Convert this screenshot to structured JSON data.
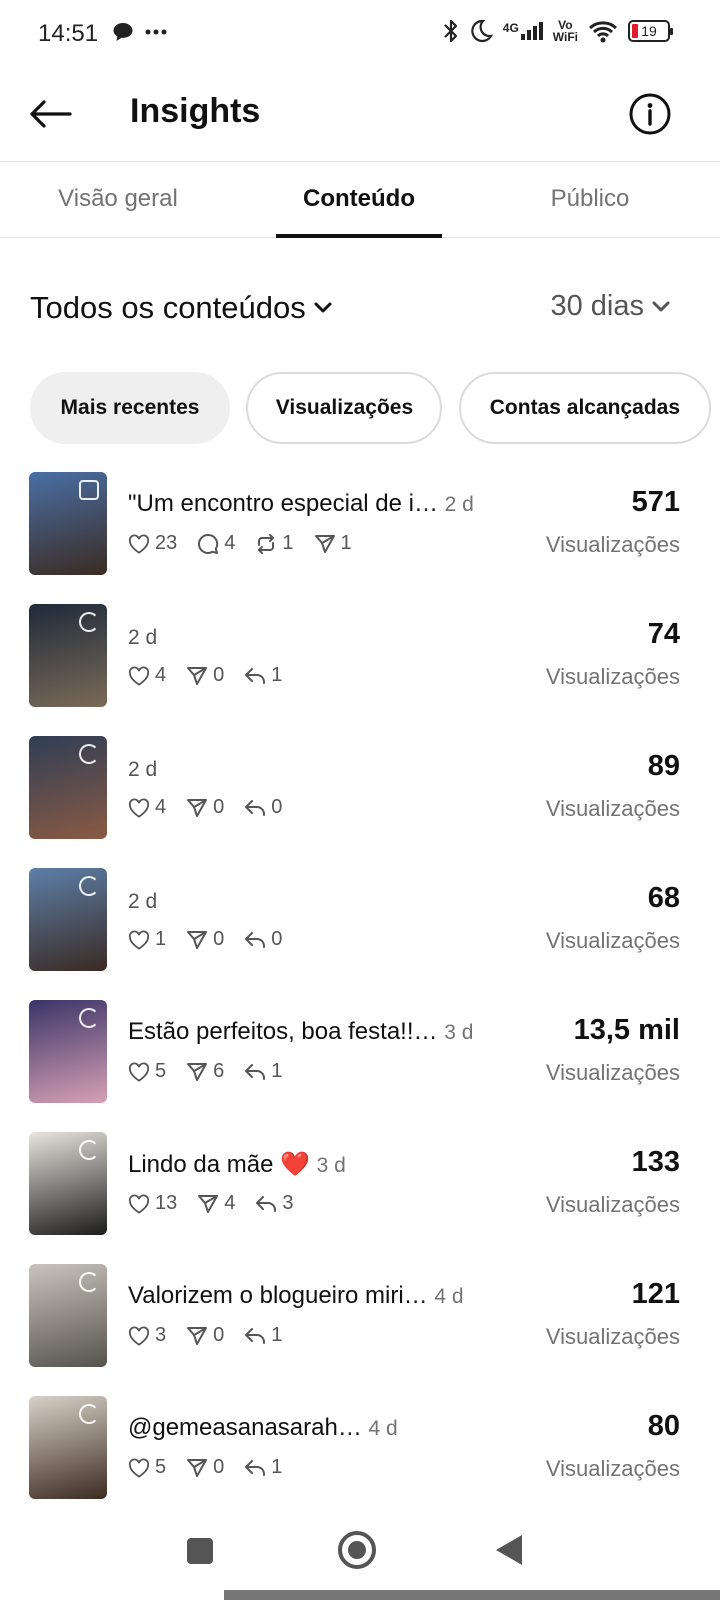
{
  "status_bar": {
    "time": "14:51",
    "left_icons": [
      "chat-bubble-icon",
      "more-dots-icon"
    ],
    "network": "4G",
    "vowifi_top": "Vo",
    "vowifi_bottom": "WiFi",
    "battery": "19"
  },
  "header": {
    "title": "Insights"
  },
  "tabs": [
    {
      "label": "Visão geral",
      "active": false
    },
    {
      "label": "Conteúdo",
      "active": true
    },
    {
      "label": "Público",
      "active": false
    }
  ],
  "filters": {
    "content_type": "Todos os conteúdos",
    "period": "30 dias"
  },
  "sort_chips": [
    {
      "label": "Mais recentes",
      "selected": true
    },
    {
      "label": "Visualizações",
      "selected": false
    },
    {
      "label": "Contas alcançadas",
      "selected": false
    }
  ],
  "posts": [
    {
      "caption": "\"Um encontro especial de i…",
      "age": "2 d",
      "likes": "23",
      "comments": "4",
      "reposts": "1",
      "shares": "1",
      "replies": null,
      "value": "571",
      "metric": "Visualizações",
      "thumb_color_a": "#4a6fa5",
      "thumb_color_b": "#3b2b22"
    },
    {
      "caption": "",
      "age": "2 d",
      "likes": "4",
      "comments": null,
      "reposts": null,
      "shares": "0",
      "replies": "1",
      "value": "74",
      "metric": "Visualizações",
      "thumb_color_a": "#1f2a3a",
      "thumb_color_b": "#7a6a58"
    },
    {
      "caption": "",
      "age": "2 d",
      "likes": "4",
      "comments": null,
      "reposts": null,
      "shares": "0",
      "replies": "0",
      "value": "89",
      "metric": "Visualizações",
      "thumb_color_a": "#2f3e55",
      "thumb_color_b": "#8a5a44"
    },
    {
      "caption": "",
      "age": "2 d",
      "likes": "1",
      "comments": null,
      "reposts": null,
      "shares": "0",
      "replies": "0",
      "value": "68",
      "metric": "Visualizações",
      "thumb_color_a": "#5d7fa8",
      "thumb_color_b": "#3a2a24"
    },
    {
      "caption": "Estão perfeitos, boa festa!!…",
      "age": "3 d",
      "likes": "5",
      "comments": null,
      "reposts": null,
      "shares": "6",
      "replies": "1",
      "value": "13,5 mil",
      "metric": "Visualizações",
      "thumb_color_a": "#3a3468",
      "thumb_color_b": "#d7a0b4"
    },
    {
      "caption": "Lindo da mãe ❤️",
      "age": "3 d",
      "likes": "13",
      "comments": null,
      "reposts": null,
      "shares": "4",
      "replies": "3",
      "value": "133",
      "metric": "Visualizações",
      "thumb_color_a": "#e8e4de",
      "thumb_color_b": "#1c1c1c"
    },
    {
      "caption": "Valorizem o blogueiro miri…",
      "age": "4 d",
      "likes": "3",
      "comments": null,
      "reposts": null,
      "shares": "0",
      "replies": "1",
      "value": "121",
      "metric": "Visualizações",
      "thumb_color_a": "#c9c5bd",
      "thumb_color_b": "#56524c"
    },
    {
      "caption": "@gemeasanasarah…",
      "age": "4 d",
      "likes": "5",
      "comments": null,
      "reposts": null,
      "shares": "0",
      "replies": "1",
      "value": "80",
      "metric": "Visualizações",
      "thumb_color_a": "#d8d2c8",
      "thumb_color_b": "#3d2b22"
    }
  ]
}
